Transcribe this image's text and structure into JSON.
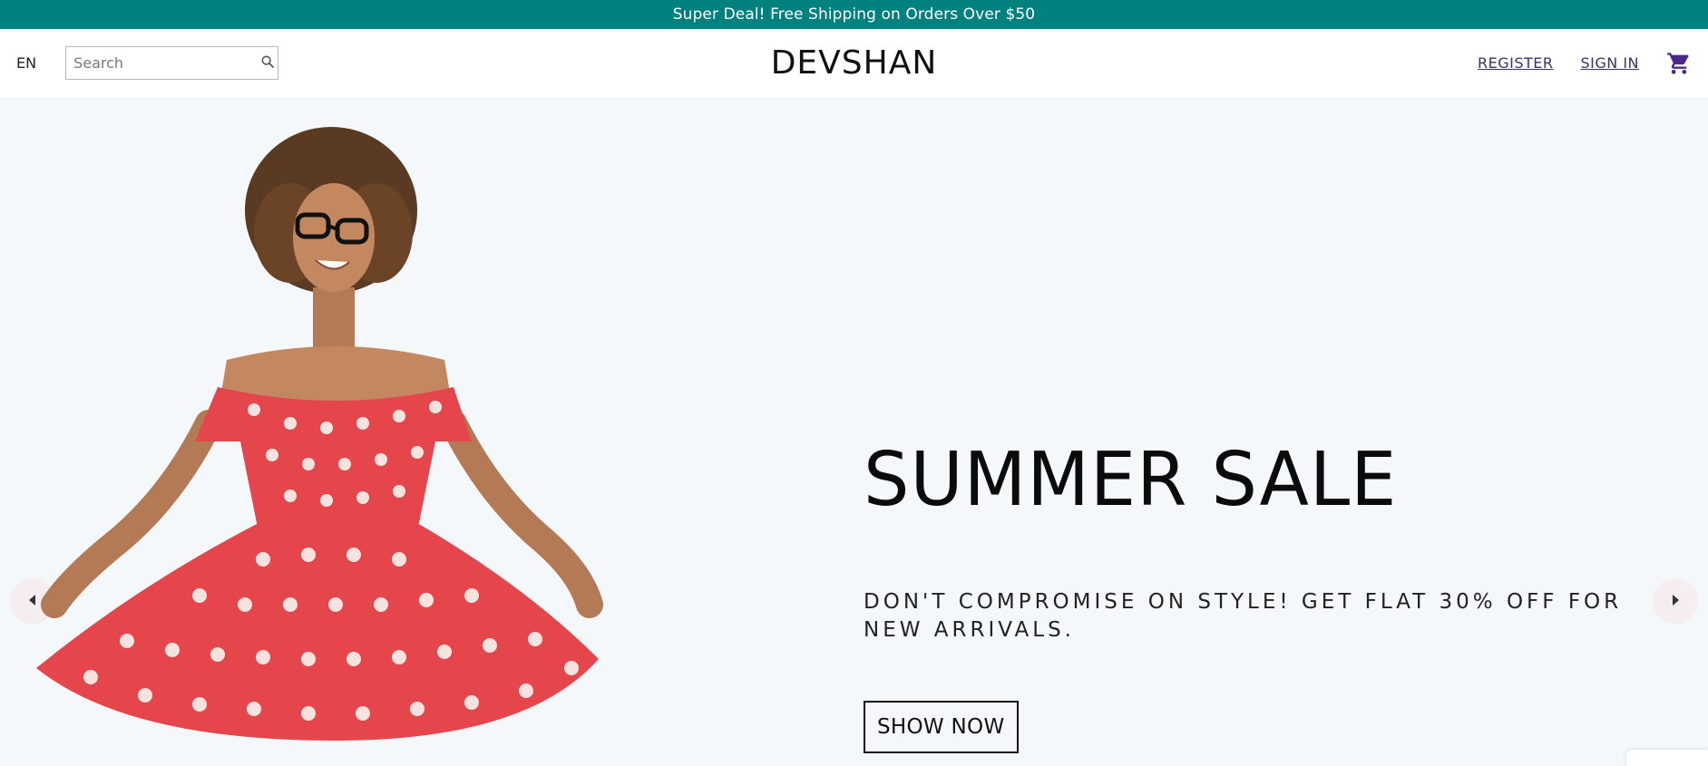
{
  "announcement": {
    "text": "Super Deal! Free Shipping on Orders Over $50",
    "background": "#00807f"
  },
  "header": {
    "language": "EN",
    "search": {
      "placeholder": "Search",
      "value": "",
      "icon": "search-icon"
    },
    "logo": "DEVSHAN",
    "register_label": "REGISTER",
    "signin_label": "SIGN IN",
    "cart_icon": "shopping-cart-icon",
    "link_color": "#3f2f6b"
  },
  "slider": {
    "background": "#f4f8fa",
    "title": "SUMMER SALE",
    "description": "DON'T COMPROMISE ON STYLE! GET FLAT 30% OFF FOR NEW ARRIVALS.",
    "button_label": "SHOW NOW",
    "left_arrow_icon": "arrow-left-icon",
    "right_arrow_icon": "arrow-right-icon",
    "dress_color": "#e5464b"
  }
}
